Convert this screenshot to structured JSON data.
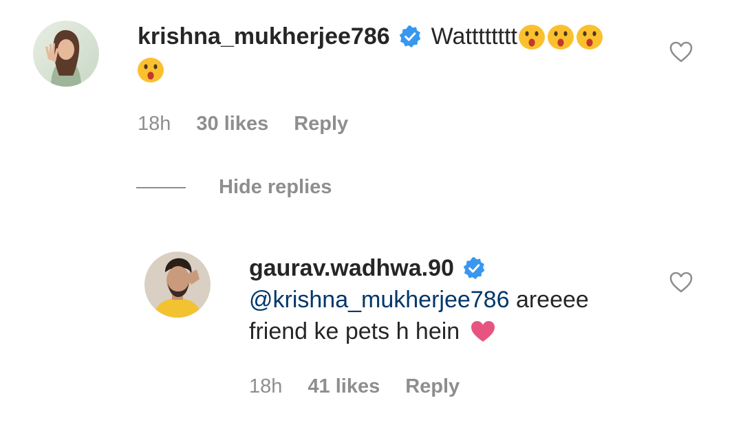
{
  "comment": {
    "username": "krishna_mukherjee786",
    "text": "Watttttttt",
    "emoji_icon": "astonished-face-emoji",
    "emoji_count": 4,
    "time": "18h",
    "likes": "30 likes",
    "reply_label": "Reply",
    "avatar_icon": "avatar-woman"
  },
  "hide_replies_label": "Hide replies",
  "reply": {
    "username": "gaurav.wadhwa.90",
    "mention": "@krishna_mukherjee786",
    "text_after_mention": " areeee",
    "line2": "friend ke pets h hein",
    "heart_emoji_icon": "pink-heart-emoji",
    "time": "18h",
    "likes": "41 likes",
    "reply_label": "Reply",
    "avatar_icon": "avatar-man"
  },
  "colors": {
    "verified_blue": "#3897f0",
    "mention_blue": "#00376b",
    "meta_gray": "#8e8e8e",
    "heart_pink": "#e75480"
  }
}
